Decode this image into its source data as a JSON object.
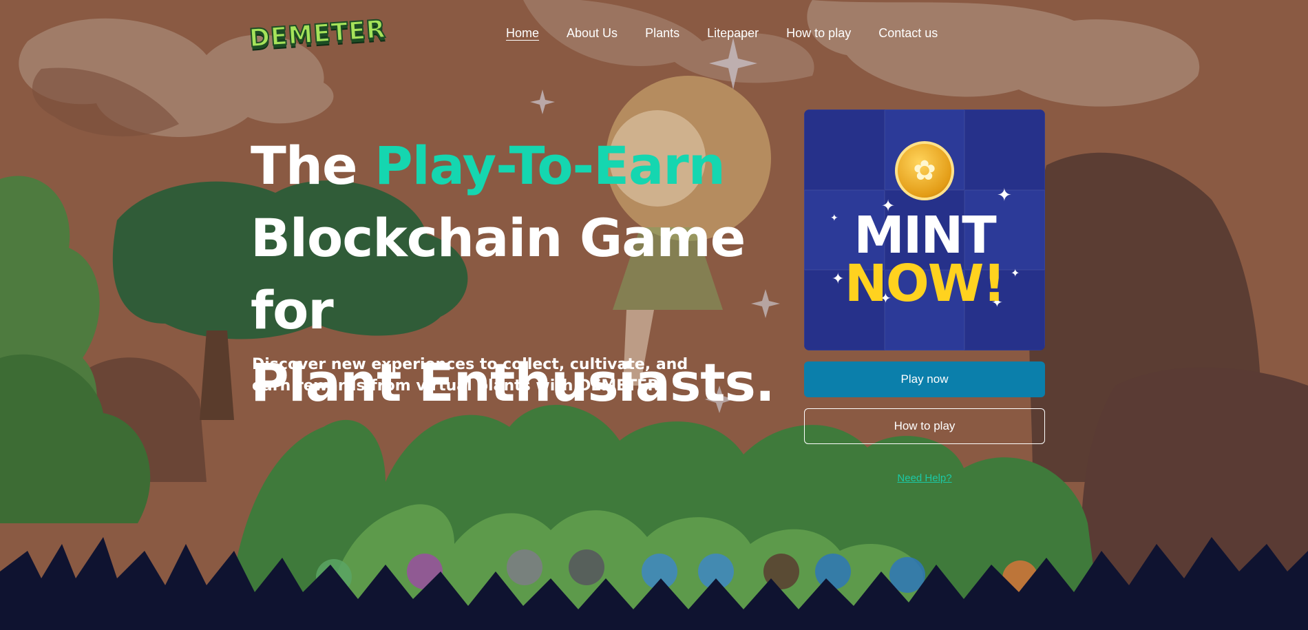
{
  "brand": {
    "logo_text": "DEMETER"
  },
  "nav": {
    "items": [
      {
        "label": "Home",
        "active": true
      },
      {
        "label": "About Us"
      },
      {
        "label": "Plants"
      },
      {
        "label": "Litepaper"
      },
      {
        "label": "How to play"
      },
      {
        "label": "Contact us"
      }
    ]
  },
  "hero": {
    "title_prefix": "The",
    "title_accent": "Play-To-Earn",
    "title_line2": "Blockchain Game for",
    "title_line3": "Plant Enthusiasts.",
    "subtitle": "Discover new experiences to collect, cultivate, and earn rewards from virtual plants with DEMETER."
  },
  "mint_card": {
    "line1": "MINT",
    "line2": "NOW!"
  },
  "actions": {
    "play_label": "Play now",
    "how_label": "How to play",
    "help_label": "Need Help?"
  },
  "colors": {
    "accent": "#15d6b0",
    "primary_button": "#0b7fab",
    "mint_yellow": "#ffd21f",
    "background": "#8a5a43"
  }
}
